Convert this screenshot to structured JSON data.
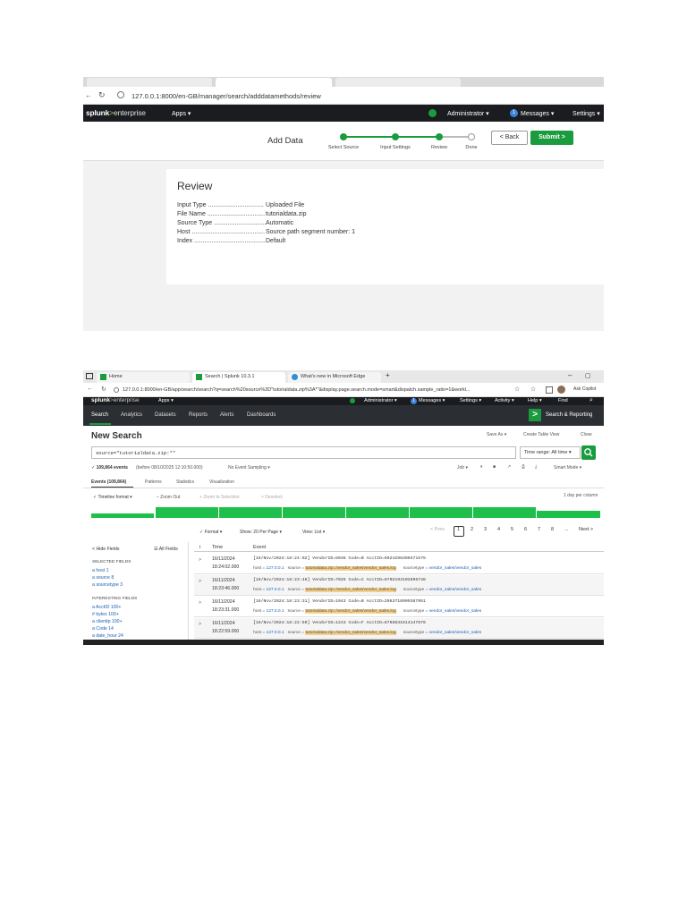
{
  "screenshot1": {
    "address": "127.0.0.1:8000/en-GB/manager/search/adddatamethods/review",
    "logo": {
      "main": "splunk",
      "sep": ">",
      "sub": "enterprise"
    },
    "nav": {
      "apps": "Apps ▾",
      "admin": "Administrator ▾",
      "messages_count": "1",
      "messages": "Messages ▾",
      "settings": "Settings ▾"
    },
    "header_title": "Add Data",
    "steps": [
      "Select Source",
      "Input Settings",
      "Review",
      "Done"
    ],
    "back_label": "< Back",
    "submit_label": "Submit >",
    "review": {
      "title": "Review",
      "rows": [
        {
          "label": "Input Type ................................",
          "value": "Uploaded File"
        },
        {
          "label": "File Name .................................",
          "value": "tutorialdata.zip"
        },
        {
          "label": "Source Type ..............................",
          "value": "Automatic"
        },
        {
          "label": "Host ..........................................",
          "value": "Source path segment number: 1"
        },
        {
          "label": "Index .........................................",
          "value": "Default"
        }
      ]
    }
  },
  "screenshot2": {
    "tabs": [
      "Home",
      "Search | Splunk 10.3.1",
      "What's new in Microsoft Edge"
    ],
    "address": "127.0.0.1:8000/en-GB/app/search/search?q=search%20source%3D\"tutorialdata.zip%3A*\"&display.page.search.mode=smart&dispatch.sample_ratio=1&workl...",
    "ask_copilot": "Ask Copilot",
    "logo": {
      "main": "splunk",
      "sep": ">",
      "sub": "enterprise"
    },
    "nav": {
      "apps": "Apps ▾",
      "admin": "Administrator ▾",
      "messages_count": "1",
      "messages": "Messages ▾",
      "settings": "Settings ▾",
      "activity": "Activity ▾",
      "help": "Help ▾",
      "find": "Find"
    },
    "app_nav": [
      "Search",
      "Analytics",
      "Datasets",
      "Reports",
      "Alerts",
      "Dashboards"
    ],
    "app_name": "Search & Reporting",
    "page_title": "New Search",
    "actions": [
      "Save As ▾",
      "Create Table View",
      "Close"
    ],
    "query": "source=\"tutorialdata.zip:*\"",
    "time_range": "Time range: All time ▾",
    "events_count": "✓ 109,864 events",
    "events_before": "(before 08/10/2025 12:10:50.000)",
    "sampling": "No Event Sampling ▾",
    "job": "Job ▾",
    "smart_mode": "Smart Mode ▾",
    "result_tabs": [
      "Events (109,864)",
      "Patterns",
      "Statistics",
      "Visualization"
    ],
    "timeline": {
      "format": "✓ Timeline format ▾",
      "zoom_out": "– Zoom Out",
      "zoom_sel": "+ Zoom to Selection",
      "deselect": "× Deselect",
      "scale": "1 day per column"
    },
    "list_controls": {
      "format": "✓ Format ▾",
      "show": "Show: 20 Per Page ▾",
      "view": "View: List ▾"
    },
    "pager": {
      "prev": "< Prev",
      "pages": [
        "1",
        "2",
        "3",
        "4",
        "5",
        "6",
        "7",
        "8",
        "..."
      ],
      "next": "Next >"
    },
    "fields": {
      "hide": "< Hide Fields",
      "all": "☰ All Fields",
      "selected_h": "SELECTED FIELDS",
      "selected": [
        "a host 1",
        "a source 8",
        "a sourcetype 3"
      ],
      "interesting_h": "INTERESTING FIELDS",
      "interesting": [
        "a AcctID 100+",
        "# bytes 100+",
        "a clientip 100+",
        "a Code 14",
        "a date_hour 24"
      ]
    },
    "columns": [
      "i",
      "Time",
      "Event"
    ],
    "events": [
      {
        "date": "16/11/2024",
        "time": "18:24:02.000",
        "raw": "[16/Nov/2024:18:24:02] VendorID=5036 Code=B AcctID=6024298300471575"
      },
      {
        "date": "16/11/2024",
        "time": "18:23:46.000",
        "raw": "[16/Nov/2024:18:23:46] VendorID=7026 Code=C AcctID=8702194102896748"
      },
      {
        "date": "16/11/2024",
        "time": "18:23:31.000",
        "raw": "[16/Nov/2024:18:23:31] VendorID=1043 Code=B AcctID=2063718909387951"
      },
      {
        "date": "16/11/2024",
        "time": "18:22:59.000",
        "raw": "[16/Nov/2024:18:22:59] VendorID=1243 Code=F AcctID=8768831614147676"
      }
    ],
    "meta": {
      "host_label": "host = ",
      "host": "127.0.0.1",
      "source_label": "source = ",
      "source": "tutorialdata.zip:./vendor_sales/vendor_sales.log",
      "st_label": "sourcetype = ",
      "sourcetype": "vendor_sales/vendor_sales"
    }
  },
  "colors": {
    "splunk_green": "#1a9c3e",
    "timeline_green": "#1ec04b",
    "nav_dark": "#1a1c20",
    "link": "#1a5fb4"
  }
}
